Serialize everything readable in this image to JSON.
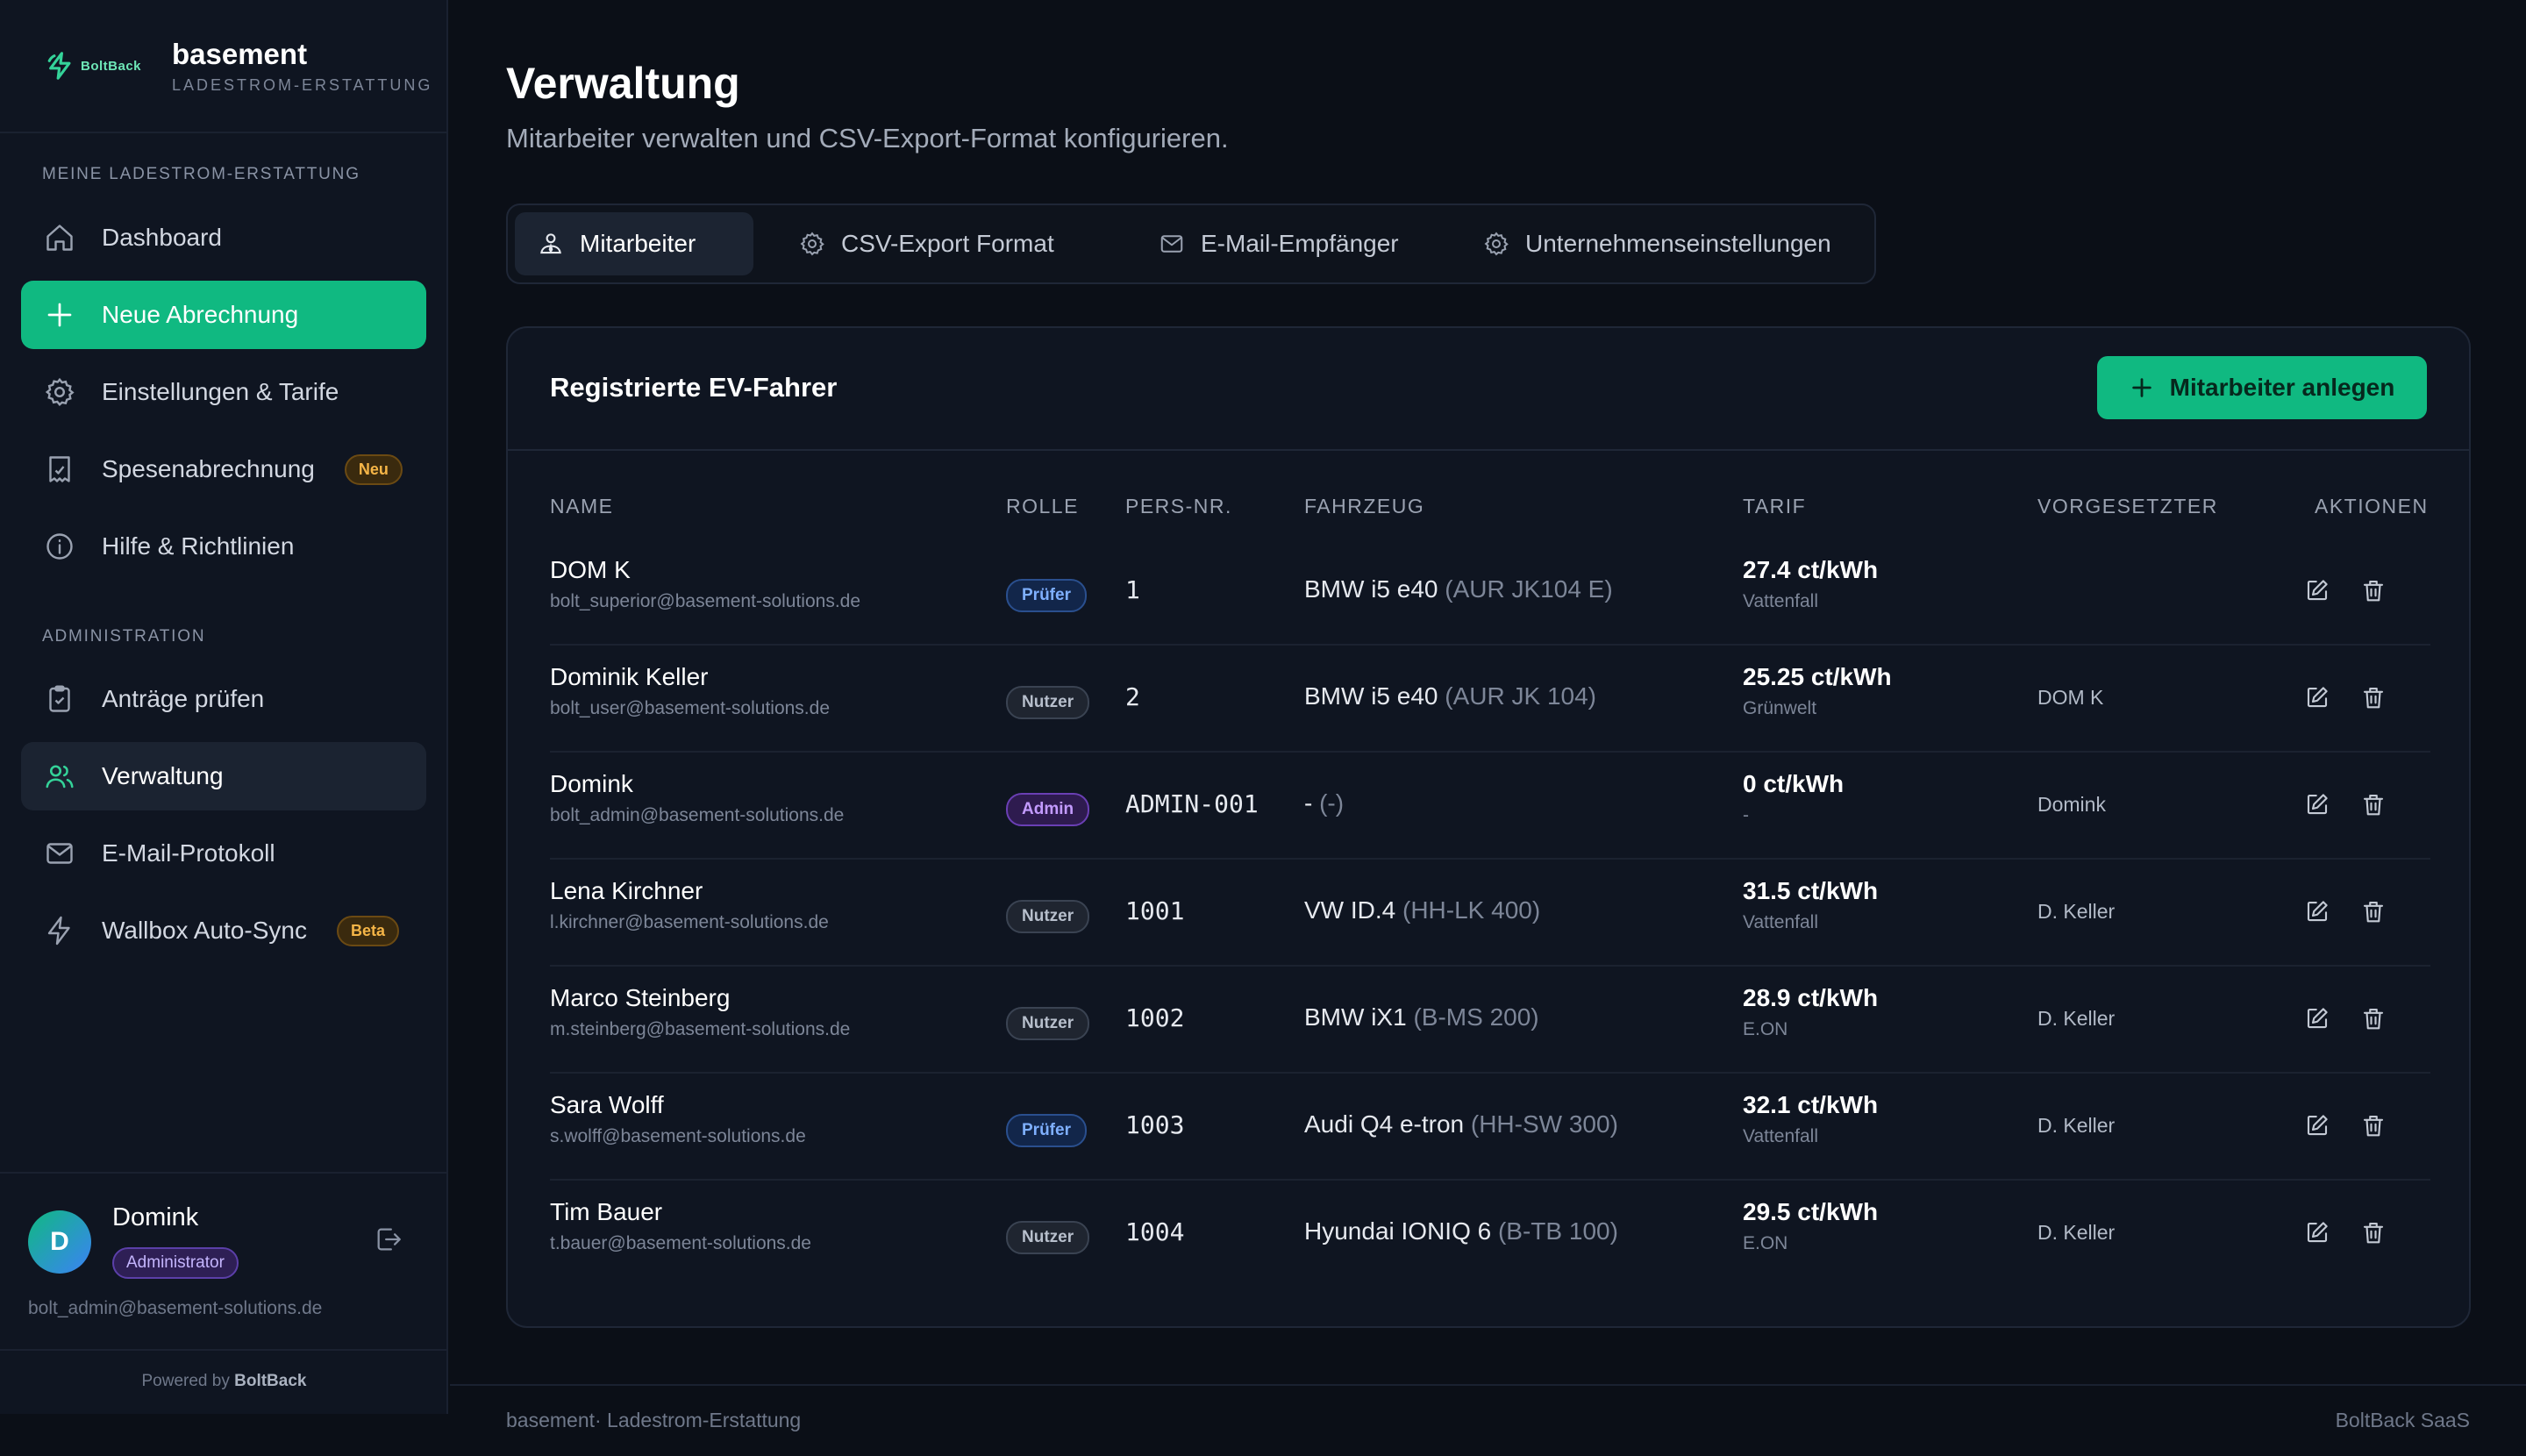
{
  "brand": {
    "logo_text": "BoltBack",
    "name": "basement",
    "subtitle": "LADESTROM-ERSTATTUNG"
  },
  "sidebar": {
    "section1_label": "MEINE LADESTROM-ERSTATTUNG",
    "section2_label": "ADMINISTRATION",
    "items": [
      {
        "label": "Dashboard",
        "icon": "home-icon"
      },
      {
        "label": "Neue Abrechnung",
        "icon": "plus-icon"
      },
      {
        "label": "Einstellungen & Tarife",
        "icon": "gear-icon"
      },
      {
        "label": "Spesenabrechnung",
        "icon": "receipt-icon",
        "badge": "Neu"
      },
      {
        "label": "Hilfe & Richtlinien",
        "icon": "info-icon"
      },
      {
        "label": "Anträge prüfen",
        "icon": "clipboard-check-icon"
      },
      {
        "label": "Verwaltung",
        "icon": "users-icon"
      },
      {
        "label": "E-Mail-Protokoll",
        "icon": "mail-icon"
      },
      {
        "label": "Wallbox Auto-Sync",
        "icon": "lightning-icon",
        "badge": "Beta"
      }
    ]
  },
  "user": {
    "initial": "D",
    "name": "Domink",
    "role": "Administrator",
    "email": "bolt_admin@basement-solutions.de"
  },
  "powered": {
    "prefix": "Powered by ",
    "brand": "BoltBack"
  },
  "page": {
    "title": "Verwaltung",
    "subtitle": "Mitarbeiter verwalten und CSV-Export-Format konfigurieren."
  },
  "tabs": [
    {
      "label": "Mitarbeiter",
      "icon": "user-tie-icon",
      "active": true
    },
    {
      "label": "CSV-Export Format",
      "icon": "gear-icon"
    },
    {
      "label": "E-Mail-Empfänger",
      "icon": "mail-icon"
    },
    {
      "label": "Unternehmenseinstellungen",
      "icon": "gear-icon"
    }
  ],
  "card": {
    "title": "Registrierte EV-Fahrer",
    "add_button": "Mitarbeiter anlegen"
  },
  "table": {
    "headers": [
      "NAME",
      "ROLLE",
      "PERS-NR.",
      "FAHRZEUG",
      "TARIF",
      "VORGESETZTER",
      "AKTIONEN"
    ],
    "rows": [
      {
        "name": "DOM K",
        "email": "bolt_superior@basement-solutions.de",
        "role": "Prüfer",
        "pers": "1",
        "car": "BMW i5 e40",
        "plate": " (AUR JK104 E)",
        "tarif": "27.4 ct/kWh",
        "provider": "Vattenfall",
        "boss": ""
      },
      {
        "name": "Dominik Keller",
        "email": "bolt_user@basement-solutions.de",
        "role": "Nutzer",
        "pers": "2",
        "car": "BMW i5 e40",
        "plate": " (AUR JK 104)",
        "tarif": "25.25 ct/kWh",
        "provider": "Grünwelt",
        "boss": "DOM K"
      },
      {
        "name": "Domink",
        "email": "bolt_admin@basement-solutions.de",
        "role": "Admin",
        "pers": "ADMIN-001",
        "car": "-",
        "plate": " (-)",
        "tarif": "0 ct/kWh",
        "provider": "-",
        "boss": "Domink"
      },
      {
        "name": "Lena Kirchner",
        "email": "l.kirchner@basement-solutions.de",
        "role": "Nutzer",
        "pers": "1001",
        "car": "VW ID.4",
        "plate": " (HH-LK 400)",
        "tarif": "31.5 ct/kWh",
        "provider": "Vattenfall",
        "boss": "D. Keller"
      },
      {
        "name": "Marco Steinberg",
        "email": "m.steinberg@basement-solutions.de",
        "role": "Nutzer",
        "pers": "1002",
        "car": "BMW iX1",
        "plate": " (B-MS 200)",
        "tarif": "28.9 ct/kWh",
        "provider": "E.ON",
        "boss": "D. Keller"
      },
      {
        "name": "Sara Wolff",
        "email": "s.wolff@basement-solutions.de",
        "role": "Prüfer",
        "pers": "1003",
        "car": "Audi Q4 e-tron",
        "plate": " (HH-SW 300)",
        "tarif": "32.1 ct/kWh",
        "provider": "Vattenfall",
        "boss": "D. Keller"
      },
      {
        "name": "Tim Bauer",
        "email": "t.bauer@basement-solutions.de",
        "role": "Nutzer",
        "pers": "1004",
        "car": "Hyundai IONIQ 6",
        "plate": " (B-TB 100)",
        "tarif": "29.5 ct/kWh",
        "provider": "E.ON",
        "boss": "D. Keller"
      }
    ]
  },
  "footer": {
    "left": "basement· Ladestrom-Erstattung",
    "right": "BoltBack SaaS"
  }
}
